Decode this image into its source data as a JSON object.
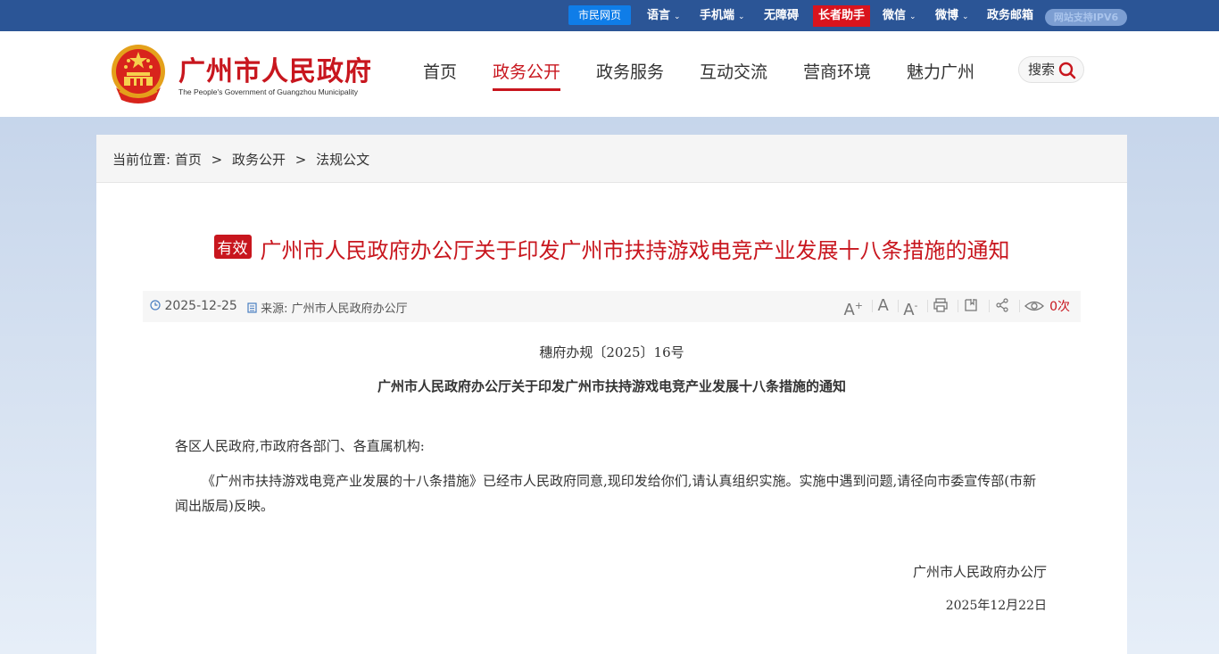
{
  "topbar": {
    "citizen_web": "市民网页",
    "language": "语言",
    "mobile": "手机端",
    "accessibility": "无障碍",
    "elder_assistant": "长者助手",
    "wechat": "微信",
    "weibo": "微博",
    "gov_mail": "政务邮箱",
    "ipv6": "网站支持IPV6",
    "chevron": "⌄"
  },
  "header": {
    "site_title": "广州市人民政府",
    "site_subtitle": "The People's Government of Guangzhou Municipality",
    "nav": [
      {
        "label": "首页"
      },
      {
        "label": "政务公开"
      },
      {
        "label": "政务服务"
      },
      {
        "label": "互动交流"
      },
      {
        "label": "营商环境"
      },
      {
        "label": "魅力广州"
      }
    ],
    "active_nav": "政务公开",
    "search_label": "搜索"
  },
  "breadcrumb": {
    "prefix": "当前位置:",
    "items": [
      "首页",
      "政务公开",
      "法规公文"
    ],
    "separator": ">"
  },
  "document": {
    "status": "有效",
    "title": "广州市人民政府办公厅关于印发广州市扶持游戏电竞产业发展十八条措施的通知",
    "date": "2025-12-25",
    "source_label": "来源:",
    "source": "广州市人民政府办公厅",
    "views": "0次",
    "doc_number": "穗府办规〔2025〕16号",
    "heading": "广州市人民政府办公厅关于印发广州市扶持游戏电竞产业发展十八条措施的通知",
    "addressee": "各区人民政府,市政府各部门、各直属机构:",
    "body": "《广州市扶持游戏电竞产业发展的十八条措施》已经市人民政府同意,现印发给你们,请认真组织实施。实施中遇到问题,请径向市委宣传部(市新闻出版局)反映。",
    "signature_org": "广州市人民政府办公厅",
    "signature_date": "2025年12月22日"
  },
  "colors": {
    "brand_red": "#c8161e",
    "topbar_blue": "#2b5596",
    "citizen_blue": "#0f7de8"
  }
}
